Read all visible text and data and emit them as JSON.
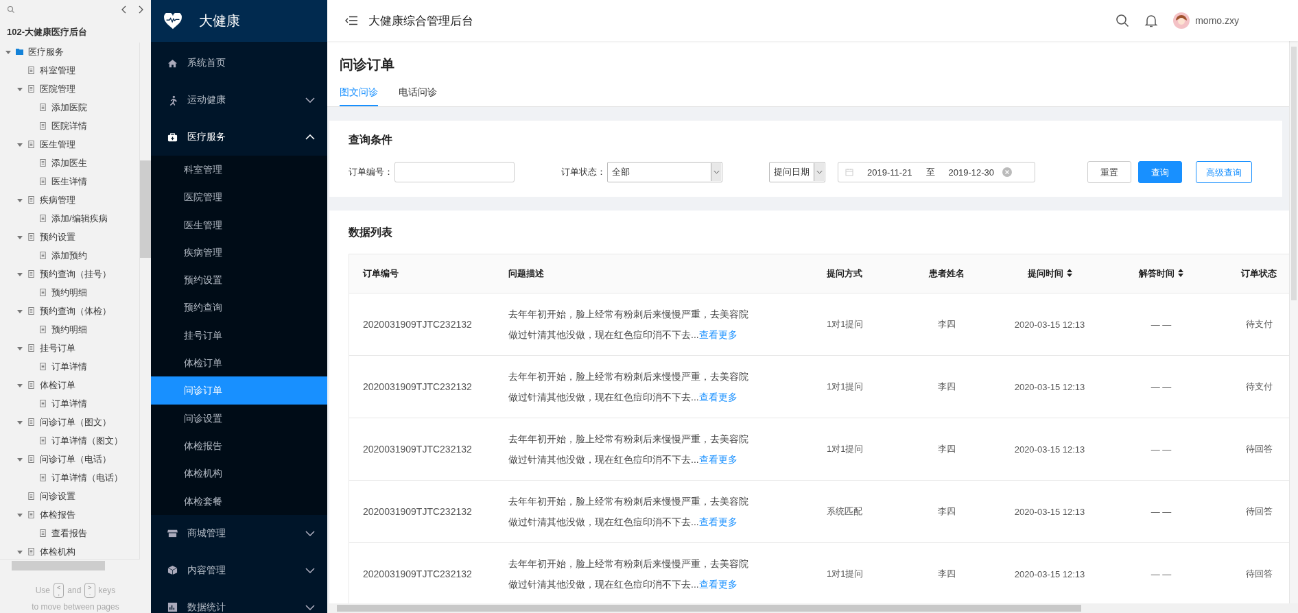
{
  "outline_panel": {
    "title": "102-大健康医疗后台",
    "tree": [
      {
        "label": "医疗服务",
        "expanded": true,
        "children": [
          {
            "label": "科室管理"
          },
          {
            "label": "医院管理",
            "expanded": true,
            "children": [
              {
                "label": "添加医院"
              },
              {
                "label": "医院详情"
              }
            ]
          },
          {
            "label": "医生管理",
            "expanded": true,
            "children": [
              {
                "label": "添加医生"
              },
              {
                "label": "医生详情"
              }
            ]
          },
          {
            "label": "疾病管理",
            "expanded": true,
            "children": [
              {
                "label": "添加/编辑疾病"
              }
            ]
          },
          {
            "label": "预约设置",
            "expanded": true,
            "children": [
              {
                "label": "添加预约"
              }
            ]
          },
          {
            "label": "预约查询（挂号）",
            "expanded": true,
            "children": [
              {
                "label": "预约明细"
              }
            ]
          },
          {
            "label": "预约查询（体检）",
            "expanded": true,
            "children": [
              {
                "label": "预约明细"
              }
            ]
          },
          {
            "label": "挂号订单",
            "expanded": true,
            "children": [
              {
                "label": "订单详情"
              }
            ]
          },
          {
            "label": "体检订单",
            "expanded": true,
            "children": [
              {
                "label": "订单详情"
              }
            ]
          },
          {
            "label": "问诊订单（图文）",
            "expanded": true,
            "children": [
              {
                "label": "订单详情（图文）"
              }
            ]
          },
          {
            "label": "问诊订单（电话）",
            "expanded": true,
            "children": [
              {
                "label": "订单详情（电话）"
              }
            ]
          },
          {
            "label": "问诊设置"
          },
          {
            "label": "体检报告",
            "expanded": true,
            "children": [
              {
                "label": "查看报告"
              }
            ]
          },
          {
            "label": "体检机构",
            "expanded": true
          }
        ]
      }
    ],
    "hint": {
      "before": "Use",
      "prev_key": [
        "<",
        ","
      ],
      "middle": "and",
      "next_key": [
        ">",
        "."
      ],
      "after": "keys",
      "line2": "to move between pages"
    }
  },
  "sidebar": {
    "brand": "大健康",
    "items": [
      {
        "label": "系统首页",
        "kind": "link"
      },
      {
        "label": "运动健康",
        "kind": "group",
        "expanded": false
      },
      {
        "label": "医疗服务",
        "kind": "group",
        "expanded": true,
        "children": [
          {
            "label": "科室管理",
            "selected": false
          },
          {
            "label": "医院管理",
            "selected": false
          },
          {
            "label": "医生管理",
            "selected": false
          },
          {
            "label": "疾病管理",
            "selected": false
          },
          {
            "label": "预约设置",
            "selected": false
          },
          {
            "label": "预约查询",
            "selected": false
          },
          {
            "label": "挂号订单",
            "selected": false
          },
          {
            "label": "体检订单",
            "selected": false
          },
          {
            "label": "问诊订单",
            "selected": true
          },
          {
            "label": "问诊设置",
            "selected": false
          },
          {
            "label": "体检报告",
            "selected": false
          },
          {
            "label": "体检机构",
            "selected": false
          },
          {
            "label": "体检套餐",
            "selected": false
          }
        ]
      },
      {
        "label": "商城管理",
        "kind": "group",
        "expanded": false
      },
      {
        "label": "内容管理",
        "kind": "group",
        "expanded": false
      },
      {
        "label": "数据统计",
        "kind": "group",
        "expanded": false
      }
    ]
  },
  "header": {
    "title": "大健康综合管理后台",
    "user": "momo.zxy"
  },
  "page": {
    "title": "问诊订单",
    "tabs": [
      {
        "label": "图文问诊",
        "selected": true
      },
      {
        "label": "电话问诊",
        "selected": false
      }
    ]
  },
  "query": {
    "title": "查询条件",
    "fields": [
      {
        "kind": "text",
        "label": "订单编号："
      },
      {
        "kind": "select",
        "label": "订单状态：",
        "value": "全部"
      },
      {
        "kind": "select",
        "value": "提问日期"
      },
      {
        "kind": "daterange",
        "start": "2019-11-21",
        "separator": "至",
        "end": "2019-12-30"
      }
    ],
    "buttons": [
      {
        "label": "重置",
        "kind": "default"
      },
      {
        "label": "查询",
        "kind": "primary"
      },
      {
        "label": "高级查询",
        "kind": "outline"
      }
    ]
  },
  "table": {
    "title": "数据列表",
    "columns": [
      {
        "label": "订单编号",
        "sortable": false
      },
      {
        "label": "问题描述",
        "sortable": false
      },
      {
        "label": "提问方式",
        "sortable": false
      },
      {
        "label": "患者姓名",
        "sortable": false
      },
      {
        "label": "提问时间",
        "sortable": true
      },
      {
        "label": "解答时间",
        "sortable": true
      },
      {
        "label": "订单状态",
        "sortable": false
      }
    ],
    "rows": [
      {
        "order_no": "2020031909TJTC232132",
        "description": "去年年初开始，脸上经常有粉刺后来慢慢严重，去美容院做过针清其他没做，现在红色痘印消不下去...",
        "more": "查看更多",
        "method": "1对1提问",
        "patient": "李四",
        "ask_time": "2020-03-15 12:13",
        "answer_time": "— —",
        "status": "待支付"
      },
      {
        "order_no": "2020031909TJTC232132",
        "description": "去年年初开始，脸上经常有粉刺后来慢慢严重，去美容院做过针清其他没做，现在红色痘印消不下去...",
        "more": "查看更多",
        "method": "1对1提问",
        "patient": "李四",
        "ask_time": "2020-03-15 12:13",
        "answer_time": "— —",
        "status": "待支付"
      },
      {
        "order_no": "2020031909TJTC232132",
        "description": "去年年初开始，脸上经常有粉刺后来慢慢严重，去美容院做过针清其他没做，现在红色痘印消不下去...",
        "more": "查看更多",
        "method": "1对1提问",
        "patient": "李四",
        "ask_time": "2020-03-15 12:13",
        "answer_time": "— —",
        "status": "待回答"
      },
      {
        "order_no": "2020031909TJTC232132",
        "description": "去年年初开始，脸上经常有粉刺后来慢慢严重，去美容院做过针清其他没做，现在红色痘印消不下去...",
        "more": "查看更多",
        "method": "系统匹配",
        "patient": "李四",
        "ask_time": "2020-03-15 12:13",
        "answer_time": "— —",
        "status": "待回答"
      },
      {
        "order_no": "2020031909TJTC232132",
        "description": "去年年初开始，脸上经常有粉刺后来慢慢严重，去美容院做过针清其他没做，现在红色痘印消不下去...",
        "more": "查看更多",
        "method": "1对1提问",
        "patient": "李四",
        "ask_time": "2020-03-15 12:13",
        "answer_time": "— —",
        "status": "待回答"
      }
    ]
  }
}
